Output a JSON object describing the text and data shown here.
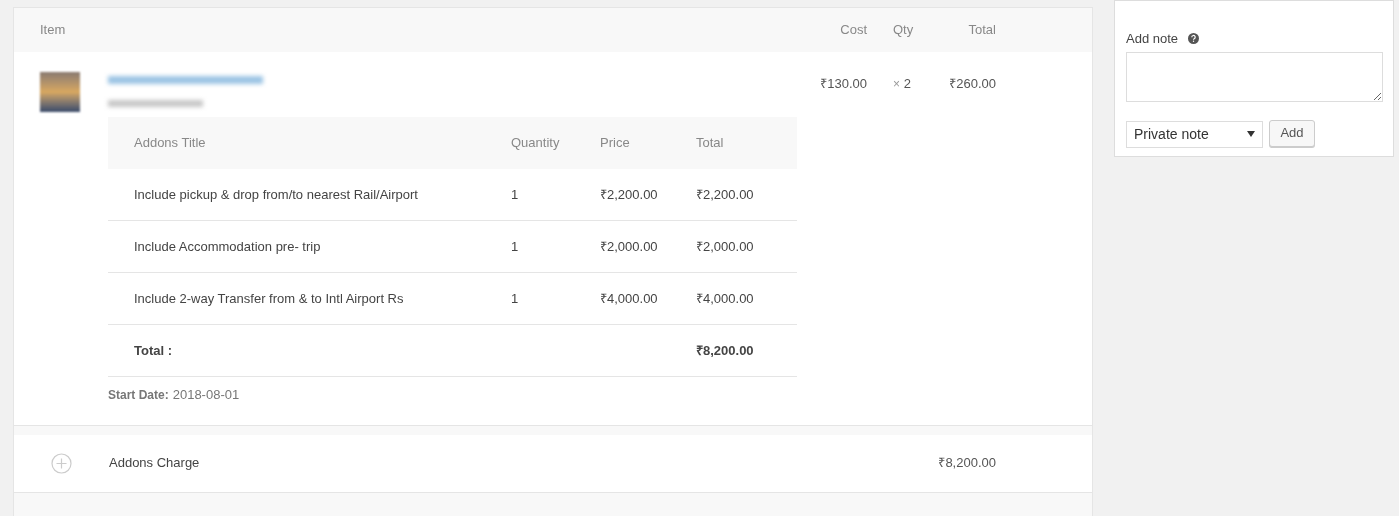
{
  "items_table": {
    "columns": [
      "Item",
      "Cost",
      "Qty",
      "Total"
    ],
    "line_item": {
      "cost": "₹130.00",
      "qty_sign": "×",
      "qty": "2",
      "total": "₹260.00",
      "addons": {
        "columns": [
          "Addons Title",
          "Quantity",
          "Price",
          "Total"
        ],
        "rows": [
          {
            "title": "Include pickup & drop from/to nearest Rail/Airport",
            "quantity": "1",
            "price": "₹2,200.00",
            "total": "₹2,200.00"
          },
          {
            "title": "Include Accommodation pre- trip",
            "quantity": "1",
            "price": "₹2,000.00",
            "total": "₹2,000.00"
          },
          {
            "title": "Include 2-way Transfer from & to Intl Airport Rs",
            "quantity": "1",
            "price": "₹4,000.00",
            "total": "₹4,000.00"
          }
        ],
        "total_label": "Total :",
        "total": "₹8,200.00"
      },
      "start_date_label": "Start Date:",
      "start_date": "2018-08-01"
    },
    "fee_row": {
      "label": "Addons Charge",
      "total": "₹8,200.00"
    }
  },
  "note_panel": {
    "label": "Add note",
    "note_type": "Private note",
    "button": "Add"
  }
}
